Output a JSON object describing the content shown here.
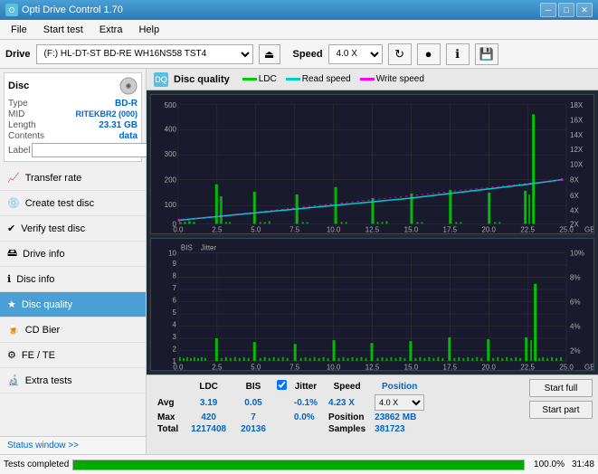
{
  "titleBar": {
    "title": "Opti Drive Control 1.70",
    "minBtn": "─",
    "maxBtn": "□",
    "closeBtn": "✕"
  },
  "menuBar": {
    "items": [
      "File",
      "Start test",
      "Extra",
      "Help"
    ]
  },
  "toolbar": {
    "driveLabel": "Drive",
    "driveValue": "(F:) HL-DT-ST BD-RE  WH16NS58 TST4",
    "ejectIcon": "⏏",
    "speedLabel": "Speed",
    "speedValue": "4.0 X",
    "icons": [
      "refresh",
      "burn",
      "info",
      "save"
    ]
  },
  "discInfo": {
    "header": "Disc",
    "type": {
      "label": "Type",
      "value": "BD-R"
    },
    "mid": {
      "label": "MID",
      "value": "RITEKBR2 (000)"
    },
    "length": {
      "label": "Length",
      "value": "23.31 GB"
    },
    "contents": {
      "label": "Contents",
      "value": "data"
    },
    "labelField": {
      "label": "Label",
      "value": "",
      "placeholder": ""
    }
  },
  "navItems": [
    {
      "id": "transfer-rate",
      "label": "Transfer rate",
      "icon": "📈"
    },
    {
      "id": "create-test-disc",
      "label": "Create test disc",
      "icon": "💿"
    },
    {
      "id": "verify-test-disc",
      "label": "Verify test disc",
      "icon": "✔"
    },
    {
      "id": "drive-info",
      "label": "Drive info",
      "icon": "🖴"
    },
    {
      "id": "disc-info",
      "label": "Disc info",
      "icon": "ℹ"
    },
    {
      "id": "disc-quality",
      "label": "Disc quality",
      "icon": "★",
      "active": true
    },
    {
      "id": "cd-bier",
      "label": "CD Bier",
      "icon": "🍺"
    },
    {
      "id": "fe-te",
      "label": "FE / TE",
      "icon": "⚙"
    },
    {
      "id": "extra-tests",
      "label": "Extra tests",
      "icon": "🔬"
    }
  ],
  "statusBar": {
    "text": "Tests completed",
    "progress": 100,
    "progressText": "100.0%",
    "time": "31:48"
  },
  "chart": {
    "title": "Disc quality",
    "iconLabel": "DQ",
    "legend": {
      "ldc": "LDC",
      "readSpeed": "Read speed",
      "writeSpeed": "Write speed"
    },
    "upperChart": {
      "yMax": 500,
      "yTicks": [
        0,
        100,
        200,
        300,
        400,
        500
      ],
      "yRightTicks": [
        "18X",
        "16X",
        "14X",
        "12X",
        "10X",
        "8X",
        "6X",
        "4X",
        "2X"
      ],
      "xTicks": [
        "0.0",
        "2.5",
        "5.0",
        "7.5",
        "10.0",
        "12.5",
        "15.0",
        "17.5",
        "20.0",
        "22.5",
        "25.0"
      ],
      "xLabel": "GB"
    },
    "lowerChart": {
      "title": "BIS",
      "jitterLabel": "Jitter",
      "yMax": 10,
      "yTicks": [
        1,
        2,
        3,
        4,
        5,
        6,
        7,
        8,
        9,
        10
      ],
      "yRightTicks": [
        "10%",
        "8%",
        "6%",
        "4%",
        "2%"
      ],
      "xTicks": [
        "0.0",
        "2.5",
        "5.0",
        "7.5",
        "10.0",
        "12.5",
        "15.0",
        "17.5",
        "20.0",
        "22.5",
        "25.0"
      ],
      "xLabel": "GB"
    },
    "stats": {
      "columns": [
        "",
        "LDC",
        "BIS",
        "",
        "Jitter",
        "Speed",
        "",
        ""
      ],
      "rows": [
        {
          "label": "Avg",
          "ldc": "3.19",
          "bis": "0.05",
          "jitter": "-0.1%",
          "speedLabel": "Position",
          "speedVal": "23862 MB"
        },
        {
          "label": "Max",
          "ldc": "420",
          "bis": "7",
          "jitter": "0.0%",
          "speedLabel": "Samples",
          "speedVal": "381723"
        },
        {
          "label": "Total",
          "ldc": "1217408",
          "bis": "20136",
          "jitter": ""
        }
      ],
      "jitterChecked": true,
      "speedValue": "4.23 X",
      "speedSelectValue": "4.0 X",
      "startFull": "Start full",
      "startPart": "Start part"
    }
  }
}
